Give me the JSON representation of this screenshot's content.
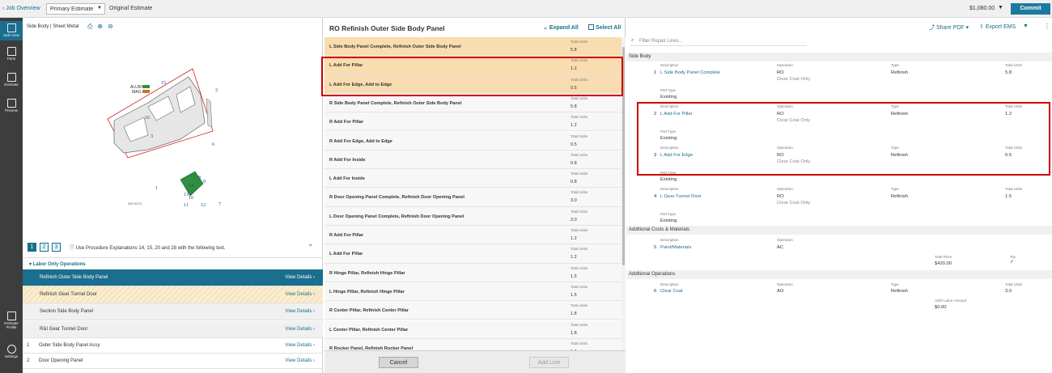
{
  "topbar": {
    "back_label": "Job Overview",
    "estimate_select": "Primary Estimate",
    "original_estimate": "Original Estimate",
    "amount": "$1,080.00",
    "commit_label": "Commit"
  },
  "nav": {
    "items": [
      {
        "label": "Split View"
      },
      {
        "label": "Parts"
      },
      {
        "label": "Estimate"
      },
      {
        "label": "Preview"
      },
      {
        "label": "Estimate Profile"
      },
      {
        "label": "Settings"
      }
    ]
  },
  "left": {
    "breadcrumb": "Side Body | Sheet Metal",
    "diagram_labels": {
      "alum": "ALUM",
      "mag": "MAG",
      "code": "3N2-00173"
    },
    "pages": [
      "1",
      "2",
      "3"
    ],
    "procedure_note": "Use Procedure Explanations 14, 15, 20 and 28 with the following text.",
    "section_title": "Labor Only Operations",
    "view_details": "View Details",
    "labor_ops": [
      {
        "label": "Refinish Outer Side Body Panel"
      },
      {
        "label": "Refinish Gear Tunnel Door"
      },
      {
        "label": "Section Side Body Panel"
      },
      {
        "label": "R&I Gear Tunnel Door"
      }
    ],
    "parts": [
      {
        "num": "1",
        "label": "Outer Side Body Panel Assy"
      },
      {
        "num": "2",
        "label": "Door Opening Panel"
      }
    ]
  },
  "middle": {
    "title": "RO Refinish Outer Side Body Panel",
    "expand_all": "Expand All",
    "select_all": "Select All",
    "total_units_label": "Total Units",
    "operations": [
      {
        "name": "L Side Body Panel Complete, Refinish Outer Side Body Panel",
        "units": "5.8"
      },
      {
        "name": "L Add For Pillar",
        "units": "1.2"
      },
      {
        "name": "L Add For Edge, Add to Edge",
        "units": "0.5"
      },
      {
        "name": "R Side Body Panel Complete, Refinish Outer Side Body Panel",
        "units": "5.8"
      },
      {
        "name": "R Add For Pillar",
        "units": "1.2"
      },
      {
        "name": "R Add For Edge, Add to Edge",
        "units": "0.5"
      },
      {
        "name": "R Add For Inside",
        "units": "0.8"
      },
      {
        "name": "L Add For Inside",
        "units": "0.8"
      },
      {
        "name": "R Door Opening Panel Complete, Refinish Door Opening Panel",
        "units": "3.0"
      },
      {
        "name": "L Door Opening Panel Complete, Refinish Door Opening Panel",
        "units": "3.0"
      },
      {
        "name": "R Add For Pillar",
        "units": "1.2"
      },
      {
        "name": "L Add For Pillar",
        "units": "1.2"
      },
      {
        "name": "R Hinge Pillar, Refinish Hinge Pillar",
        "units": "1.5"
      },
      {
        "name": "L Hinge Pillar, Refinish Hinge Pillar",
        "units": "1.5"
      },
      {
        "name": "R Center Pillar, Refinish Center Pillar",
        "units": "1.8"
      },
      {
        "name": "L Center Pillar, Refinish Center Pillar",
        "units": "1.8"
      },
      {
        "name": "R Rocker Panel, Refinish Rocker Panel",
        "units": "1.0"
      }
    ],
    "cancel_label": "Cancel",
    "add_line_label": "Add Line"
  },
  "right": {
    "filter_placeholder": "Filter Repair Lines...",
    "share_pdf": "Share PDF",
    "export_ems": "Export EMS",
    "labels": {
      "description": "Description",
      "operation": "Operation",
      "type": "Type",
      "total_units": "Total Units",
      "part_type": "Part Type",
      "total_price": "Total Price",
      "tax": "Tax",
      "addl_labor": "Add'l Labor Amount"
    },
    "sections": {
      "side_body": "Side Body",
      "additional_costs": "Additional Costs & Materials",
      "additional_ops": "Additional Operations"
    },
    "lines": [
      {
        "num": "1",
        "desc": "L Side Body Panel Complete",
        "op": "RO",
        "op_sub": "Clear Coat Only",
        "type": "Refinish",
        "units": "5.8",
        "part_type": "Existing"
      },
      {
        "num": "2",
        "desc": "L Add For Pillar",
        "op": "RO",
        "op_sub": "Clear Coat Only",
        "type": "Refinish",
        "units": "1.2",
        "part_type": "Existing"
      },
      {
        "num": "3",
        "desc": "L Add For Edge",
        "op": "RO",
        "op_sub": "Clear Coat Only",
        "type": "Refinish",
        "units": "0.5",
        "part_type": "Existing"
      },
      {
        "num": "4",
        "desc": "L Gear Tunnel Door",
        "op": "RO",
        "op_sub": "Clear Coat Only",
        "type": "Refinish",
        "units": "1.5",
        "part_type": "Existing"
      }
    ],
    "cost_line": {
      "num": "5",
      "desc": "Paint/Materials",
      "op": "AC",
      "price": "$420.00",
      "tax": "✓"
    },
    "addl_op": {
      "num": "6",
      "desc": "Clear Coat",
      "op": "AO",
      "type": "Refinish",
      "units": "3.0",
      "addl_amount": "$0.00"
    }
  }
}
